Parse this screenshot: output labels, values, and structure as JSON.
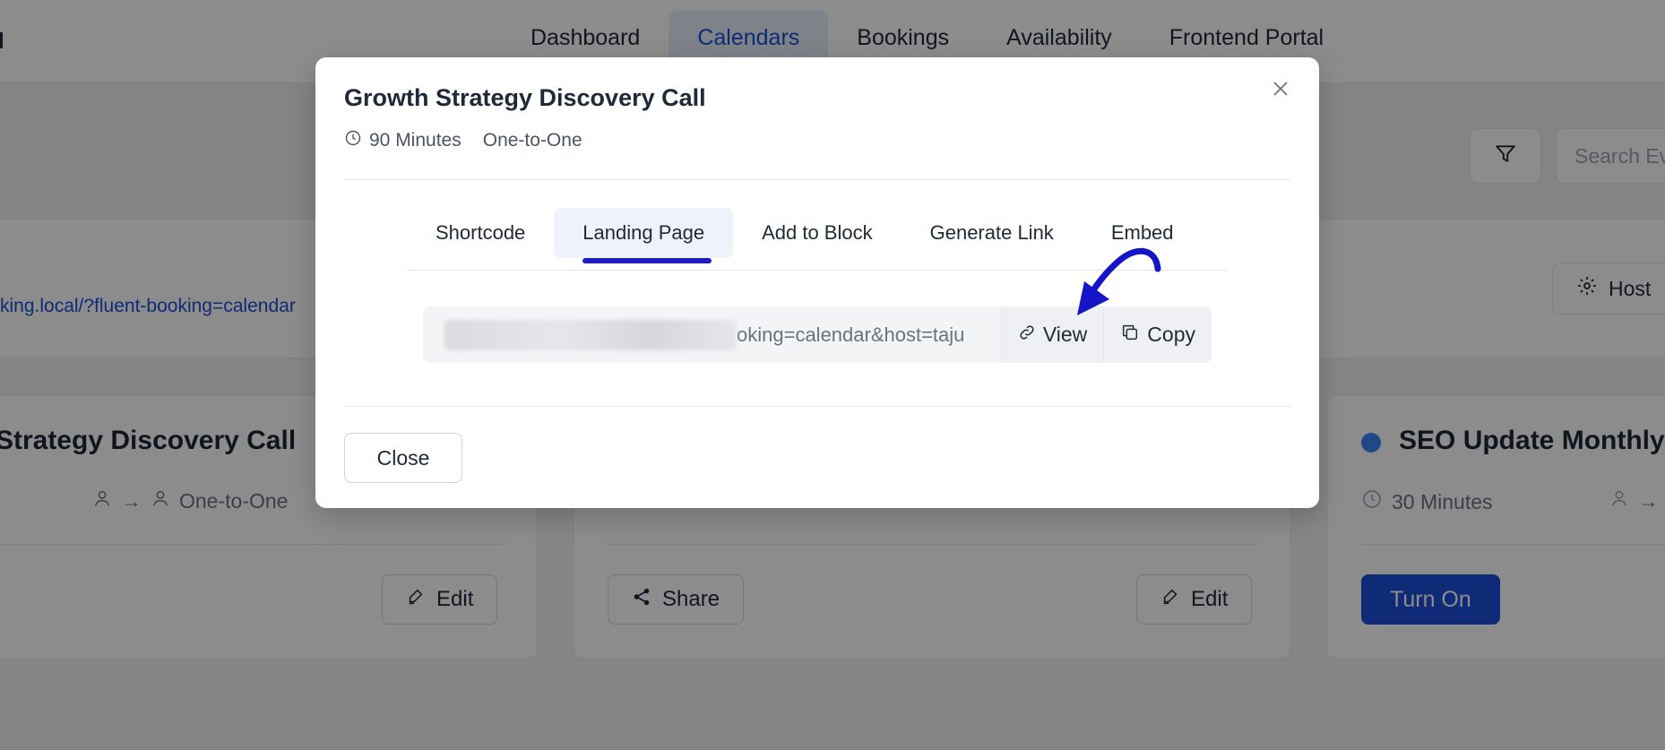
{
  "nav": {
    "items": [
      {
        "label": "Dashboard",
        "active": false
      },
      {
        "label": "Calendars",
        "active": true
      },
      {
        "label": "Bookings",
        "active": false
      },
      {
        "label": "Availability",
        "active": false
      },
      {
        "label": "Frontend Portal",
        "active": false
      }
    ]
  },
  "toolbar": {
    "search_placeholder": "Search Ev",
    "host_label": "Host",
    "filter_icon": "filter-icon"
  },
  "calendar_link": "king.local/?fluent-booking=calendar",
  "cards": [
    {
      "title": "Strategy Discovery Call",
      "type": "One-to-One",
      "edit_label": "Edit"
    },
    {
      "share_label": "Share",
      "edit_label": "Edit"
    },
    {
      "title": "SEO Update Monthly",
      "duration": "30 Minutes",
      "turn_on_label": "Turn On",
      "dot_color": "#3b82f6"
    }
  ],
  "modal": {
    "title": "Growth Strategy Discovery Call",
    "duration": "90 Minutes",
    "event_type": "One-to-One",
    "tabs": [
      "Shortcode",
      "Landing Page",
      "Add to Block",
      "Generate Link",
      "Embed"
    ],
    "active_tab": "Landing Page",
    "url_value": "oking=calendar&host=taju",
    "view_label": "View",
    "copy_label": "Copy",
    "close_label": "Close"
  },
  "colors": {
    "accent": "#1d4ed8",
    "annotation": "#1515c8"
  }
}
